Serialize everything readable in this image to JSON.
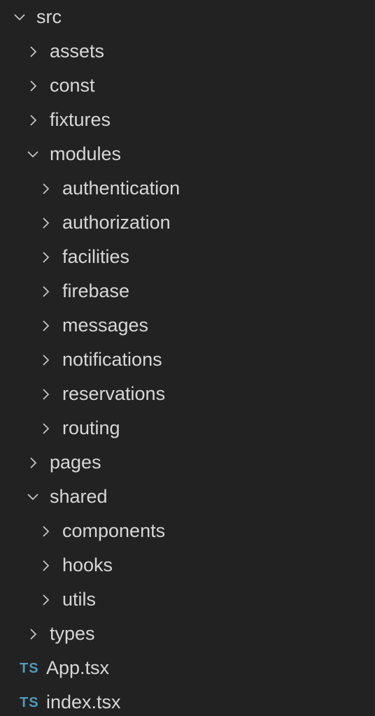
{
  "tree": {
    "root": {
      "label": "src",
      "expanded": true,
      "icon": "chevron-down-icon"
    },
    "items": [
      {
        "label": "assets",
        "expanded": false,
        "icon": "chevron-right-icon"
      },
      {
        "label": "const",
        "expanded": false,
        "icon": "chevron-right-icon"
      },
      {
        "label": "fixtures",
        "expanded": false,
        "icon": "chevron-right-icon"
      },
      {
        "label": "modules",
        "expanded": true,
        "icon": "chevron-down-icon"
      },
      {
        "label": "authentication",
        "expanded": false,
        "icon": "chevron-right-icon"
      },
      {
        "label": "authorization",
        "expanded": false,
        "icon": "chevron-right-icon"
      },
      {
        "label": "facilities",
        "expanded": false,
        "icon": "chevron-right-icon"
      },
      {
        "label": "firebase",
        "expanded": false,
        "icon": "chevron-right-icon"
      },
      {
        "label": "messages",
        "expanded": false,
        "icon": "chevron-right-icon"
      },
      {
        "label": "notifications",
        "expanded": false,
        "icon": "chevron-right-icon"
      },
      {
        "label": "reservations",
        "expanded": false,
        "icon": "chevron-right-icon"
      },
      {
        "label": "routing",
        "expanded": false,
        "icon": "chevron-right-icon"
      },
      {
        "label": "pages",
        "expanded": false,
        "icon": "chevron-right-icon"
      },
      {
        "label": "shared",
        "expanded": true,
        "icon": "chevron-down-icon"
      },
      {
        "label": "components",
        "expanded": false,
        "icon": "chevron-right-icon"
      },
      {
        "label": "hooks",
        "expanded": false,
        "icon": "chevron-right-icon"
      },
      {
        "label": "utils",
        "expanded": false,
        "icon": "chevron-right-icon"
      },
      {
        "label": "types",
        "expanded": false,
        "icon": "chevron-right-icon"
      },
      {
        "label": "App.tsx",
        "badge": "TS",
        "icon": "typescript-file-icon"
      },
      {
        "label": "index.tsx",
        "badge": "TS",
        "icon": "typescript-file-icon"
      }
    ]
  },
  "colors": {
    "background": "#222222",
    "text": "#d7d7d7",
    "chevron": "#c5c5c5",
    "ts_badge": "#519aba"
  }
}
